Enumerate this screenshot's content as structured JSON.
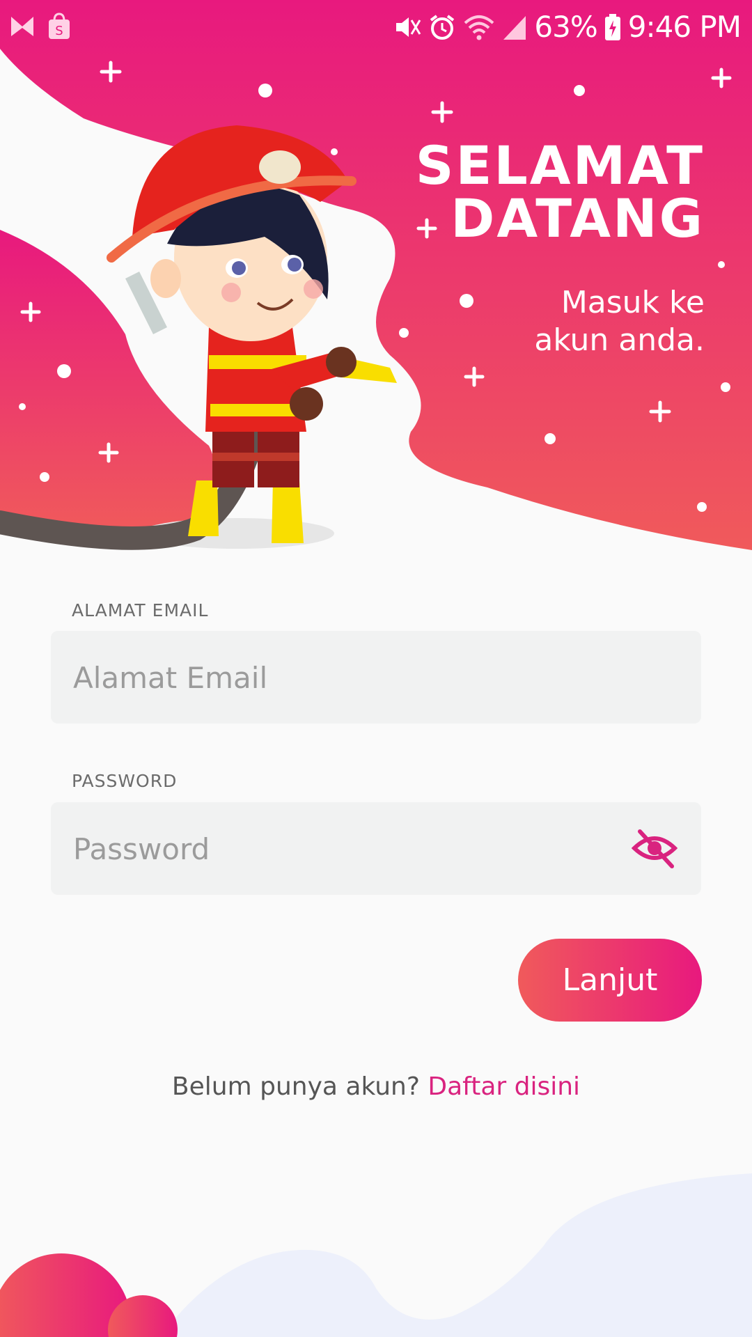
{
  "status_bar": {
    "battery": "63%",
    "time": "9:46 PM",
    "icons": [
      "app-icon",
      "shopee-icon",
      "mute-icon",
      "alarm-icon",
      "wifi-icon",
      "signal-icon",
      "battery-charging-icon"
    ]
  },
  "hero": {
    "title": "SELAMAT\nDATANG",
    "subtitle": "Masuk ke\nakun anda.",
    "illustration": "firefighter-illustration"
  },
  "form": {
    "email_label": "ALAMAT EMAIL",
    "email_placeholder": "Alamat Email",
    "email_value": "",
    "password_label": "PASSWORD",
    "password_placeholder": "Password",
    "password_value": "",
    "password_toggle_icon": "eye-off-icon",
    "continue_label": "Lanjut"
  },
  "signup": {
    "prompt": "Belum punya akun?",
    "link": "Daftar disini"
  },
  "colors": {
    "primary": "#e8197e",
    "accent": "#f05a5b",
    "background": "#fafafa",
    "input_bg": "#f1f2f2"
  }
}
